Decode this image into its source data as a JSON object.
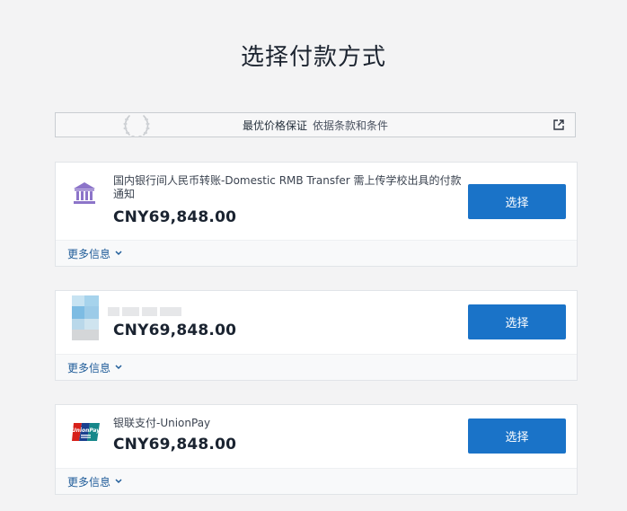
{
  "page": {
    "title": "选择付款方式"
  },
  "guarantee": {
    "strong": "最优价格保证",
    "weak": "依据条款和条件"
  },
  "methods": [
    {
      "name": "国内银行间人民币转账-Domestic RMB Transfer 需上传学校出具的付款通知",
      "price": "CNY69,848.00",
      "select_label": "选择",
      "more_info_label": "更多信息",
      "icon": "bank-icon"
    },
    {
      "name": "",
      "price": "CNY69,848.00",
      "select_label": "选择",
      "more_info_label": "更多信息",
      "icon": "blurred-logo-icon"
    },
    {
      "name": "银联支付-UnionPay",
      "price": "CNY69,848.00",
      "select_label": "选择",
      "more_info_label": "更多信息",
      "icon": "unionpay-icon"
    }
  ],
  "colors": {
    "accent": "#1a73c8",
    "link": "#1f5c99",
    "bank_icon": "#8c74c9"
  }
}
